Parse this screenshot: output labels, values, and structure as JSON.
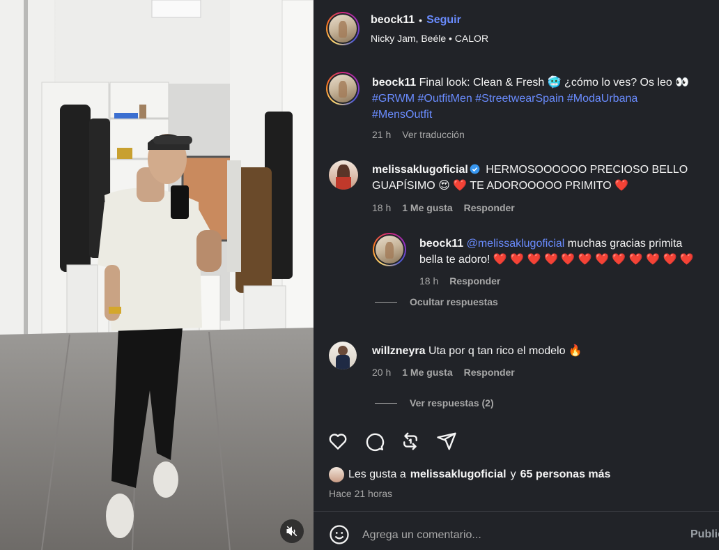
{
  "post": {
    "author": "beock11",
    "separator": "•",
    "follow_label": "Seguir",
    "audio": "Nicky Jam, Beéle • CALOR",
    "mute_icon": "speaker-muted-icon"
  },
  "caption": {
    "username": "beock11",
    "text_before": "Final look: Clean & Fresh 🥶 ¿cómo lo ves? Os leo 👀",
    "hashtags": [
      "#GRWM",
      "#OutfitMen",
      "#StreetwearSpain",
      "#ModaUrbana",
      "#MensOutfit"
    ],
    "time": "21 h",
    "translate_label": "Ver traducción"
  },
  "comments": [
    {
      "username": "melissaklugoficial",
      "verified": true,
      "text": "HERMOSOOOOOO PRECIOSO BELLO GUAPÍSIMO 😍 ❤️ TE ADOROOOOO PRIMITO ❤️",
      "time": "18 h",
      "likes": "1 Me gusta",
      "reply_label": "Responder",
      "replies": [
        {
          "username": "beock11",
          "mention": "@melissaklugoficial",
          "text": "muchas gracias primita bella te adoro! ❤️ ❤️ ❤️ ❤️ ❤️ ❤️ ❤️ ❤️ ❤️ ❤️ ❤️ ❤️",
          "time": "18 h",
          "reply_label": "Responder"
        }
      ],
      "toggle_label": "Ocultar respuestas"
    },
    {
      "username": "willzneyra",
      "verified": false,
      "text": "Uta por q tan rico el modelo 🔥",
      "time": "20 h",
      "likes": "1 Me gusta",
      "reply_label": "Responder",
      "toggle_label": "Ver respuestas (2)"
    }
  ],
  "actions": {
    "icons": [
      "heart-icon",
      "comment-icon",
      "repost-icon",
      "share-icon"
    ]
  },
  "likes": {
    "prefix": "Les gusta a",
    "user": "melissaklugoficial",
    "connector": "y",
    "others": "65 personas más"
  },
  "time_ago": "Hace 21 horas",
  "composer": {
    "placeholder": "Agrega un comentario...",
    "publish_label": "Publicar"
  },
  "colors": {
    "panel_bg": "#212328",
    "link_blue": "#6a8cff",
    "muted_text": "#a8a8a8",
    "heart_red": "#ff3040"
  }
}
